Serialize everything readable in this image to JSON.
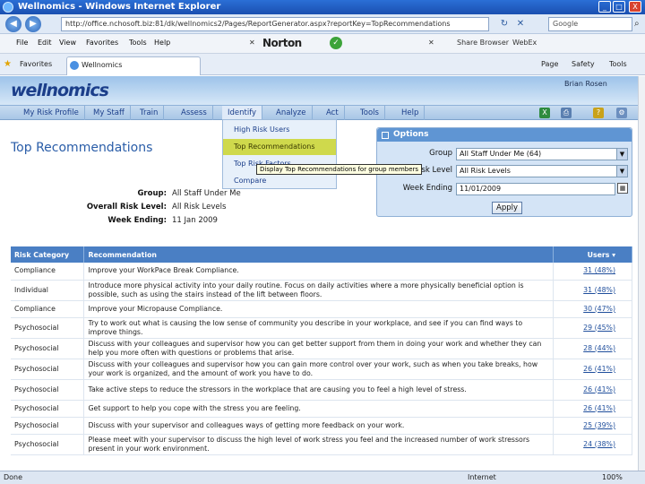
{
  "window": {
    "title": "Wellnomics - Windows Internet Explorer",
    "minimize": "_",
    "maximize": "□",
    "close": "X"
  },
  "addressbar": {
    "back": "◀",
    "forward": "▶",
    "url": "http://office.nchosoft.biz:81/dk/wellnomics2/Pages/ReportGenerator.aspx?reportKey=TopRecommendations",
    "refresh": "↻",
    "stop": "✕",
    "search_placeholder": "Google",
    "search_icon": "magnifier-icon"
  },
  "menubar": {
    "items": [
      "File",
      "Edit",
      "View",
      "Favorites",
      "Tools",
      "Help"
    ],
    "norton_close": "✕",
    "norton": "Norton",
    "toolbar_close": "✕",
    "share_browser": "Share Browser",
    "webex": "WebEx"
  },
  "tabbar": {
    "favorites": "Favorites",
    "tab_title": "Wellnomics",
    "commands": [
      "Page",
      "Safety",
      "Tools"
    ]
  },
  "app": {
    "brand": "wellnomics",
    "user_name": "Brian Rosen",
    "nav": [
      "My Risk Profile",
      "My Staff",
      "Train",
      "Assess",
      "Identify",
      "Analyze",
      "Act",
      "Tools",
      "Help"
    ],
    "identify_menu": [
      "High Risk Users",
      "Top Recommendations",
      "Top Risk Factors",
      "Compare"
    ],
    "tooltip": "Display Top Recommendations for group members",
    "page_title": "Top Recommendations",
    "summary": {
      "group_label": "Group:",
      "group_value": "All Staff Under Me",
      "risk_label": "Overall Risk Level:",
      "risk_value": "All Risk Levels",
      "week_label": "Week Ending:",
      "week_value": "11 Jan 2009"
    },
    "options": {
      "title": "Options",
      "group_label": "Group",
      "group_value": "All Staff Under Me (64)",
      "risk_label": "Risk Level",
      "risk_value": "All Risk Levels",
      "week_label": "Week Ending",
      "week_value": "11/01/2009",
      "apply": "Apply"
    },
    "table": {
      "headers": [
        "Risk Category",
        "Recommendation",
        "Users ▾"
      ],
      "rows": [
        {
          "category": "Compliance",
          "recommendation": "Improve your WorkPace Break Compliance.",
          "users": "31 (48%)"
        },
        {
          "category": "Individual",
          "recommendation": "Introduce more physical activity into your daily routine. Focus on daily activities where a more physically beneficial option is possible, such as using the stairs instead of the lift between floors.",
          "users": "31 (48%)"
        },
        {
          "category": "Compliance",
          "recommendation": "Improve your Micropause Compliance.",
          "users": "30 (47%)"
        },
        {
          "category": "Psychosocial",
          "recommendation": "Try to work out what is causing the low sense of community you describe in your workplace, and see if you can find ways to improve things.",
          "users": "29 (45%)"
        },
        {
          "category": "Psychosocial",
          "recommendation": "Discuss with your colleagues and supervisor how you can get better support from them in doing your work and whether they can help you more often with questions or problems that arise.",
          "users": "28 (44%)"
        },
        {
          "category": "Psychosocial",
          "recommendation": "Discuss with your colleagues and supervisor how you can gain more control over your work, such as when you take breaks, how your work is organized, and the amount of work you have to do.",
          "users": "26 (41%)"
        },
        {
          "category": "Psychosocial",
          "recommendation": "Take active steps to reduce the stressors in the workplace that are causing you to feel a high level of stress.",
          "users": "26 (41%)"
        },
        {
          "category": "Psychosocial",
          "recommendation": "Get support to help you cope with the stress you are feeling.",
          "users": "26 (41%)"
        },
        {
          "category": "Psychosocial",
          "recommendation": "Discuss with your supervisor and colleagues ways of getting more feedback on your work.",
          "users": "25 (39%)"
        },
        {
          "category": "Psychosocial",
          "recommendation": "Please meet with your supervisor to discuss the high level of work stress you feel and the increased number of work stressors present in your work environment.",
          "users": "24 (38%)"
        }
      ]
    }
  },
  "statusbar": {
    "text": "Done",
    "zone": "Internet",
    "zoom": "100%"
  },
  "colors": {
    "brand_blue": "#1b3e8a",
    "header_blue": "#4a7fc4",
    "dropdown_highlight": "#cfd94c"
  }
}
